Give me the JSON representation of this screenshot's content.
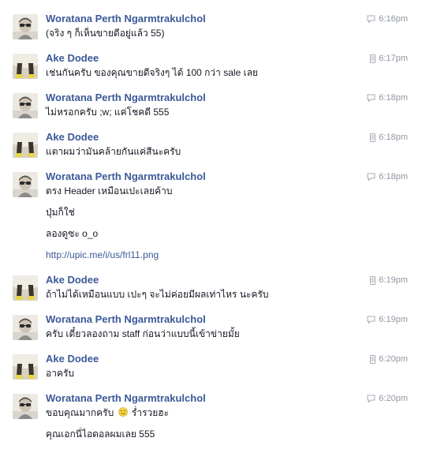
{
  "messages": [
    {
      "sender": "Woratana Perth Ngarmtrakulchol",
      "time": "6:16pm",
      "device": "chat",
      "avatar": "woratana",
      "lines": [
        {
          "text": "(จริง ๆ ก็เห็นขายดีอยู่แล้ว 55)"
        }
      ]
    },
    {
      "sender": "Ake Dodee",
      "time": "6:17pm",
      "device": "mobile",
      "avatar": "ake",
      "lines": [
        {
          "text": "เช่นกันครับ ของคุณขายดีจริงๆ ได้ 100 กว่า sale เลย"
        }
      ]
    },
    {
      "sender": "Woratana Perth Ngarmtrakulchol",
      "time": "6:18pm",
      "device": "chat",
      "avatar": "woratana",
      "lines": [
        {
          "text": "ไม่หรอกครับ ;w; แค่โชคดี 555"
        }
      ]
    },
    {
      "sender": "Ake Dodee",
      "time": "6:18pm",
      "device": "mobile",
      "avatar": "ake",
      "lines": [
        {
          "text": "แตาผมว่ามันคล้ายกันแค่สีนะครับ"
        }
      ]
    },
    {
      "sender": "Woratana Perth Ngarmtrakulchol",
      "time": "6:18pm",
      "device": "chat",
      "avatar": "woratana",
      "lines": [
        {
          "text": "ตรง Header เหมือนเปะเลยค้าบ"
        },
        {
          "text": "ปุ่มก็ใช่"
        },
        {
          "text": "ลองดูซะ o_o"
        },
        {
          "text": "http://upic.me/i/us/frl11.png",
          "link": true
        }
      ]
    },
    {
      "sender": "Ake Dodee",
      "time": "6:19pm",
      "device": "mobile",
      "avatar": "ake",
      "lines": [
        {
          "text": "ถ้าไม่ได้เหมือนแบบ เปะๆ จะไม่ค่อยมีผลเท่าไหร นะครับ"
        }
      ]
    },
    {
      "sender": "Woratana Perth Ngarmtrakulchol",
      "time": "6:19pm",
      "device": "chat",
      "avatar": "woratana",
      "lines": [
        {
          "text": "ครับ เดี๋ยวลองถาม staff ก่อนว่าแบบนี้เข้าข่ายมั้ย"
        }
      ]
    },
    {
      "sender": "Ake Dodee",
      "time": "6:20pm",
      "device": "mobile",
      "avatar": "ake",
      "lines": [
        {
          "text": "อาครับ"
        }
      ]
    },
    {
      "sender": "Woratana Perth Ngarmtrakulchol",
      "time": "6:20pm",
      "device": "chat",
      "avatar": "woratana",
      "lines": [
        {
          "text": "ขอบคุณมากครับ",
          "emoji": "smile-emoji",
          "after": "ร่ำรวยฮะ"
        },
        {
          "text": "คุณเอกนี่ไอดอลผมเลย 555"
        }
      ]
    }
  ]
}
